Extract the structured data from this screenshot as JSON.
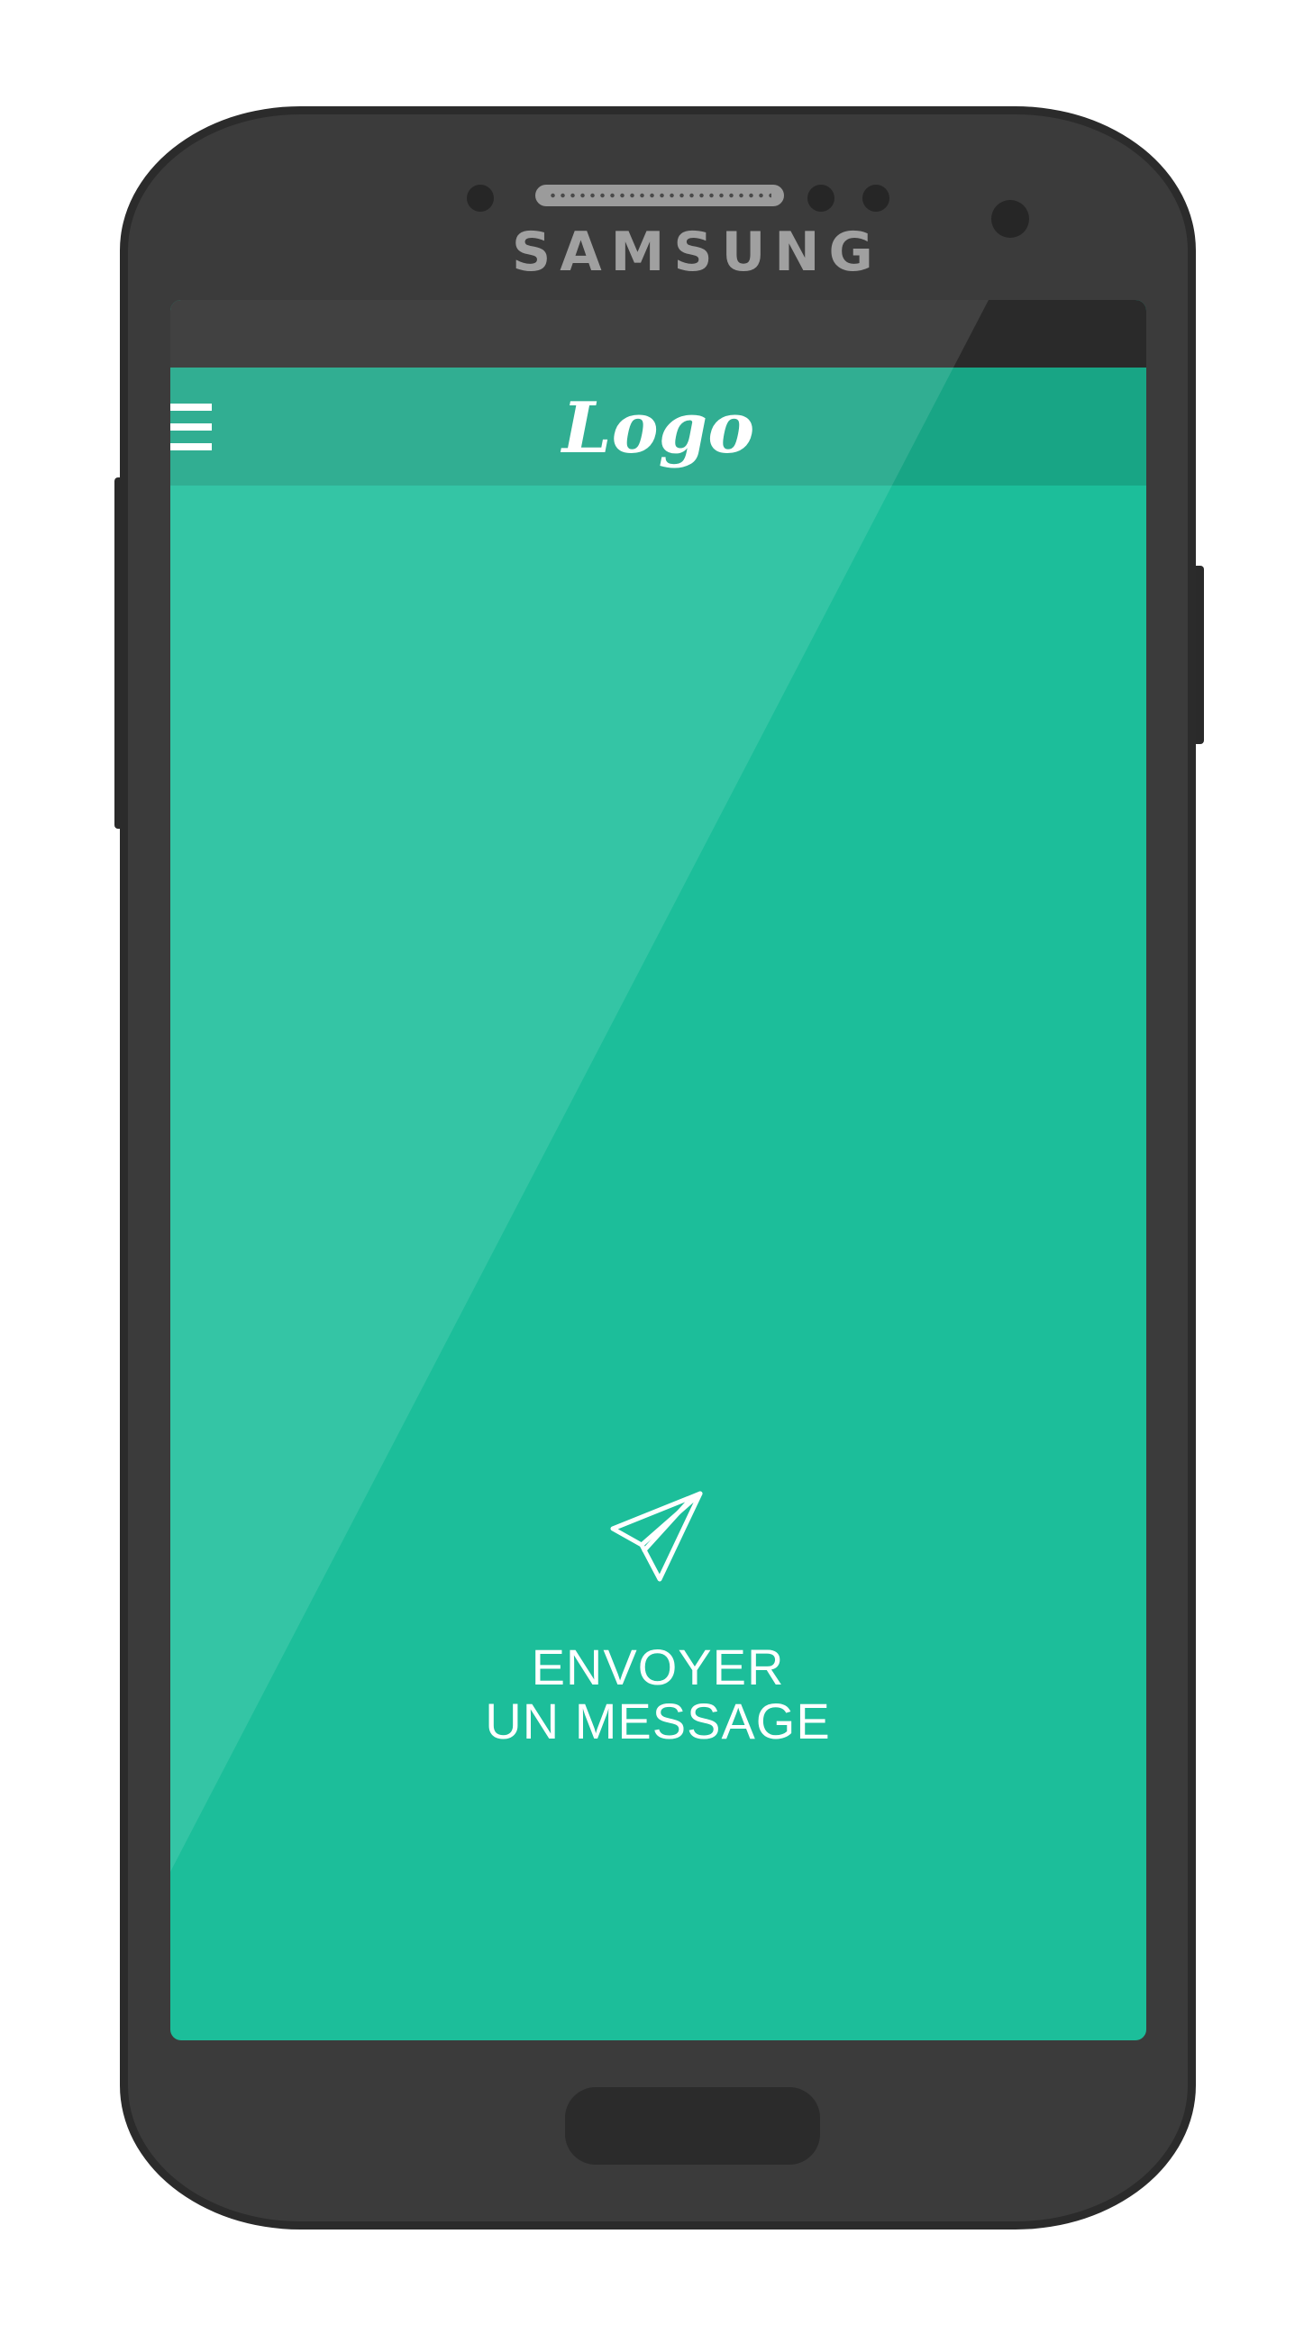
{
  "device": {
    "brand": "SAMSUNG"
  },
  "app_bar": {
    "menu_icon": "hamburger-menu-icon",
    "logo_text": "Logo"
  },
  "main": {
    "send_icon": "paper-plane-icon",
    "send_label_line1": "ENVOYER",
    "send_label_line2": "UN MESSAGE"
  },
  "colors": {
    "screen_background": "#1cbe9a",
    "app_bar": "#18a585",
    "status_bar": "#2a2a2a",
    "device_body": "#3b3b3b",
    "text": "#ffffff"
  }
}
